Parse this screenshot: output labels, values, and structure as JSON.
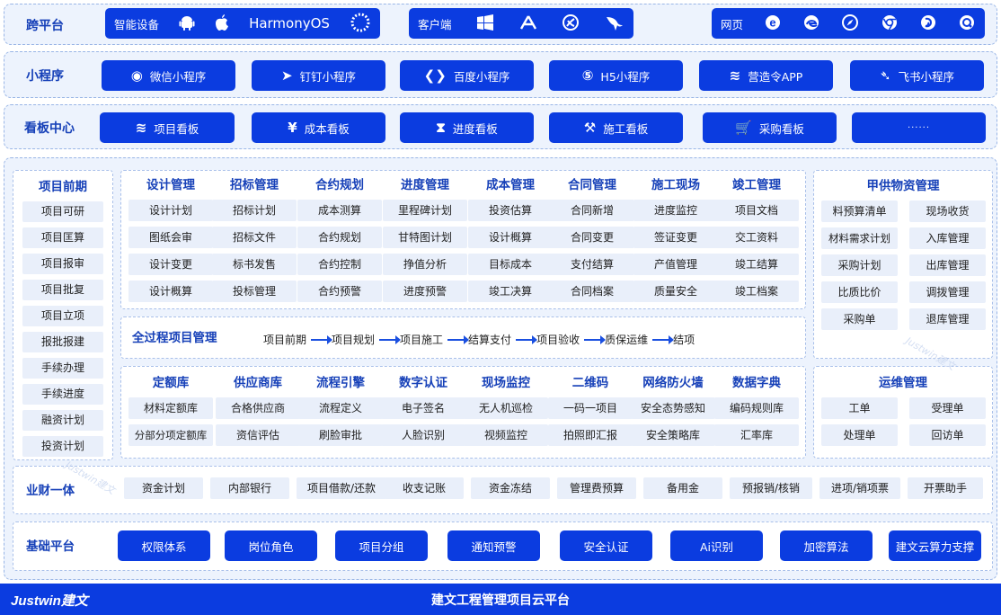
{
  "cross_platform": {
    "title": "跨平台",
    "groups": [
      {
        "label": "智能设备",
        "icons": [
          "android-icon",
          "apple-icon"
        ],
        "extra_text": "HarmonyOS",
        "extra_icon": "harmony-ring-icon"
      },
      {
        "label": "客户端",
        "icons": [
          "windows-icon",
          "app-store-icon",
          "fedora-icon",
          "kali-icon"
        ]
      },
      {
        "label": "网页",
        "icons": [
          "ie-icon",
          "edge-icon",
          "safari-icon",
          "chrome-icon",
          "firefox-icon",
          "qq-browser-icon"
        ]
      }
    ]
  },
  "mini_programs": {
    "title": "小程序",
    "items": [
      {
        "label": "微信小程序",
        "icon": "wechat-icon",
        "glyph": "◉"
      },
      {
        "label": "钉钉小程序",
        "icon": "dingtalk-icon",
        "glyph": "➤"
      },
      {
        "label": "百度小程序",
        "icon": "baidu-icon",
        "glyph": "❮❯"
      },
      {
        "label": "H5小程序",
        "icon": "html5-icon",
        "glyph": "⑤"
      },
      {
        "label": "营造令APP",
        "icon": "yingzaoling-icon",
        "glyph": "≋"
      },
      {
        "label": "飞书小程序",
        "icon": "feishu-icon",
        "glyph": "➴"
      }
    ]
  },
  "dashboard": {
    "title": "看板中心",
    "items": [
      {
        "label": "项目看板",
        "icon": "layers-icon",
        "glyph": "≋"
      },
      {
        "label": "成本看板",
        "icon": "money-bag-icon",
        "glyph": "¥"
      },
      {
        "label": "进度看板",
        "icon": "hourglass-icon",
        "glyph": "⧗"
      },
      {
        "label": "施工看板",
        "icon": "worker-icon",
        "glyph": "⚒"
      },
      {
        "label": "采购看板",
        "icon": "cart-icon",
        "glyph": "🛒"
      },
      {
        "label": "······",
        "icon": "",
        "glyph": ""
      }
    ]
  },
  "preproject": {
    "title": "项目前期",
    "items": [
      "项目可研",
      "项目匡算",
      "项目报审",
      "项目批复",
      "项目立项",
      "报批报建",
      "手续办理",
      "手续进度",
      "融资计划",
      "投资计划"
    ]
  },
  "mgmt_top": [
    {
      "title": "设计管理",
      "items": [
        "设计计划",
        "图纸会审",
        "设计变更",
        "设计概算"
      ]
    },
    {
      "title": "招标管理",
      "items": [
        "招标计划",
        "招标文件",
        "标书发售",
        "投标管理"
      ]
    },
    {
      "title": "合约规划",
      "items": [
        "成本测算",
        "合约规划",
        "合约控制",
        "合约预警"
      ]
    },
    {
      "title": "进度管理",
      "items": [
        "里程碑计划",
        "甘特图计划",
        "挣值分析",
        "进度预警"
      ]
    },
    {
      "title": "成本管理",
      "items": [
        "投资估算",
        "设计概算",
        "目标成本",
        "竣工决算"
      ]
    },
    {
      "title": "合同管理",
      "items": [
        "合同新增",
        "合同变更",
        "支付结算",
        "合同档案"
      ]
    },
    {
      "title": "施工现场",
      "items": [
        "进度监控",
        "签证变更",
        "产值管理",
        "质量安全"
      ]
    },
    {
      "title": "竣工管理",
      "items": [
        "项目文档",
        "交工资料",
        "竣工结算",
        "竣工档案"
      ]
    }
  ],
  "process": {
    "title": "全过程项目管理",
    "steps": [
      "项目前期",
      "项目规划",
      "项目施工",
      "结算支付",
      "项目验收",
      "质保运维",
      "结项"
    ]
  },
  "mgmt_bottom": [
    {
      "title": "定额库",
      "items": [
        "材料定额库",
        "分部分项定额库"
      ]
    },
    {
      "title": "供应商库",
      "items": [
        "合格供应商",
        "资信评估"
      ]
    },
    {
      "title": "流程引擎",
      "items": [
        "流程定义",
        "刷脸审批"
      ]
    },
    {
      "title": "数字认证",
      "items": [
        "电子签名",
        "人脸识别"
      ]
    },
    {
      "title": "现场监控",
      "items": [
        "无人机巡检",
        "视频监控"
      ]
    },
    {
      "title": "二维码",
      "items": [
        "一码一项目",
        "拍照即汇报"
      ]
    },
    {
      "title": "网络防火墙",
      "items": [
        "安全态势感知",
        "安全策略库"
      ]
    },
    {
      "title": "数据字典",
      "items": [
        "编码规则库",
        "汇率库"
      ]
    }
  ],
  "materials": {
    "title": "甲供物资管理",
    "rows": [
      [
        "料预算清单",
        "现场收货"
      ],
      [
        "材料需求计划",
        "入库管理"
      ],
      [
        "采购计划",
        "出库管理"
      ],
      [
        "比质比价",
        "调拨管理"
      ],
      [
        "采购单",
        "退库管理"
      ]
    ]
  },
  "ops": {
    "title": "运维管理",
    "rows": [
      [
        "工单",
        "受理单"
      ],
      [
        "处理单",
        "回访单"
      ]
    ]
  },
  "finance": {
    "title": "业财一体",
    "items": [
      "资金计划",
      "内部银行",
      "项目借款/还款",
      "收支记账",
      "资金冻结",
      "管理费预算",
      "备用金",
      "预报销/核销",
      "进项/销项票",
      "开票助手"
    ]
  },
  "base": {
    "title": "基础平台",
    "items": [
      "权限体系",
      "岗位角色",
      "项目分组",
      "通知预警",
      "安全认证",
      "Ai识别",
      "加密算法",
      "建文云算力支撑"
    ]
  },
  "footer": {
    "logo_text": "Justwin建文",
    "title": "建文工程管理项目云平台"
  },
  "watermark": "Justwin建文"
}
